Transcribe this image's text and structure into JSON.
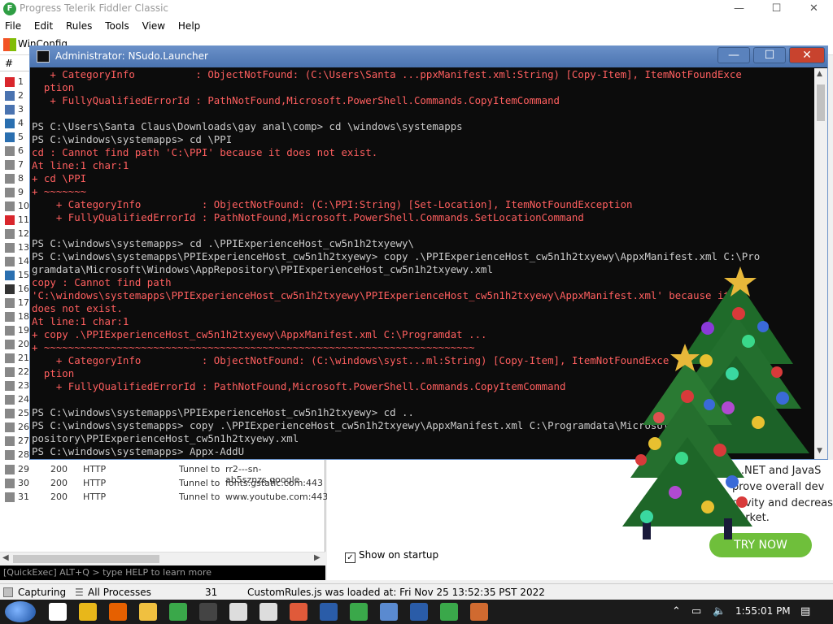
{
  "fiddler": {
    "title": "Progress Telerik Fiddler Classic",
    "window_controls": {
      "minimize": "—",
      "maximize": "☐",
      "close": "✕"
    },
    "menu": [
      "File",
      "Edit",
      "Rules",
      "Tools",
      "View",
      "Help"
    ],
    "toolbar_partial": "WinConfig",
    "sessions_header": "#",
    "sessions": [
      {
        "num": "1",
        "icon": "warning-icon",
        "color": "#d9262c"
      },
      {
        "num": "2",
        "icon": "js-icon",
        "color": "#4a73b0"
      },
      {
        "num": "3",
        "icon": "js-icon",
        "color": "#4a73b0"
      },
      {
        "num": "4",
        "icon": "html-icon",
        "color": "#2a6fb0"
      },
      {
        "num": "5",
        "icon": "script-icon",
        "color": "#2a6fb0"
      },
      {
        "num": "6",
        "icon": "lock-icon",
        "color": "#888888"
      },
      {
        "num": "7",
        "icon": "lock-icon",
        "color": "#888888"
      },
      {
        "num": "8",
        "icon": "lock-icon",
        "color": "#888888"
      },
      {
        "num": "9",
        "icon": "lock-icon",
        "color": "#888888"
      },
      {
        "num": "10",
        "icon": "lock-icon",
        "color": "#888888"
      },
      {
        "num": "11",
        "icon": "blocked-icon",
        "color": "#d9262c"
      },
      {
        "num": "12",
        "icon": "lock-icon",
        "color": "#888888"
      },
      {
        "num": "13",
        "icon": "lock-icon",
        "color": "#888888"
      },
      {
        "num": "14",
        "icon": "lock-icon",
        "color": "#888888"
      },
      {
        "num": "15",
        "icon": "doc-icon",
        "color": "#2a6fb0"
      },
      {
        "num": "16",
        "icon": "doc-icon",
        "color": "#333333"
      },
      {
        "num": "17",
        "icon": "lock-icon",
        "color": "#888888"
      },
      {
        "num": "18",
        "icon": "lock-icon",
        "color": "#888888"
      },
      {
        "num": "19",
        "icon": "lock-icon",
        "color": "#888888"
      },
      {
        "num": "20",
        "icon": "lock-icon",
        "color": "#888888"
      },
      {
        "num": "21",
        "icon": "lock-icon",
        "color": "#888888"
      },
      {
        "num": "22",
        "icon": "lock-icon",
        "color": "#888888"
      },
      {
        "num": "23",
        "icon": "lock-icon",
        "color": "#888888"
      },
      {
        "num": "24",
        "icon": "lock-icon",
        "color": "#888888"
      },
      {
        "num": "25",
        "icon": "lock-icon",
        "color": "#888888"
      },
      {
        "num": "26",
        "icon": "lock-icon",
        "color": "#888888"
      },
      {
        "num": "27",
        "icon": "lock-icon",
        "color": "#888888"
      },
      {
        "num": "28",
        "icon": "lock-icon",
        "color": "#888888"
      }
    ],
    "sessions_visible": [
      {
        "num": "29",
        "result": "200",
        "protocol": "HTTP",
        "host": "Tunnel to",
        "url": "rr2---sn-ab5sznzs.google"
      },
      {
        "num": "30",
        "result": "200",
        "protocol": "HTTP",
        "host": "Tunnel to",
        "url": "fonts.gstatic.com:443"
      },
      {
        "num": "31",
        "result": "200",
        "protocol": "HTTP",
        "host": "Tunnel to",
        "url": "www.youtube.com:443"
      }
    ],
    "quickexec": "[QuickExec] ALT+Q > type HELP to learn more",
    "promo_lines": [
      "s .NET and JavaS",
      "prove overall dev",
      "ctivity and decreas",
      "narket."
    ],
    "try_now": "TRY NOW",
    "show_on_startup": "Show on startup",
    "status": {
      "capturing": "Capturing",
      "processes": "All Processes",
      "count": "31",
      "message": "CustomRules.js was loaded at: Fri Nov 25 13:52:35 PST 2022"
    }
  },
  "console": {
    "title": "Administrator: NSudo.Launcher",
    "lines": [
      {
        "t": "   + CategoryInfo          : ObjectNotFound: (C:\\Users\\Santa ...ppxManifest.xml:String) [Copy-Item], ItemNotFoundExce",
        "k": "err"
      },
      {
        "t": "  ption",
        "k": "err"
      },
      {
        "t": "   + FullyQualifiedErrorId : PathNotFound,Microsoft.PowerShell.Commands.CopyItemCommand",
        "k": "err"
      },
      {
        "t": "",
        "k": ""
      },
      {
        "t": "PS C:\\Users\\Santa Claus\\Downloads\\gay anal\\comp> cd \\windows\\systemapps",
        "k": ""
      },
      {
        "t": "PS C:\\windows\\systemapps> cd \\PPI",
        "k": ""
      },
      {
        "t": "cd : Cannot find path 'C:\\PPI' because it does not exist.",
        "k": "err"
      },
      {
        "t": "At line:1 char:1",
        "k": "err"
      },
      {
        "t": "+ cd \\PPI",
        "k": "err"
      },
      {
        "t": "+ ~~~~~~~",
        "k": "err"
      },
      {
        "t": "    + CategoryInfo          : ObjectNotFound: (C:\\PPI:String) [Set-Location], ItemNotFoundException",
        "k": "err"
      },
      {
        "t": "    + FullyQualifiedErrorId : PathNotFound,Microsoft.PowerShell.Commands.SetLocationCommand",
        "k": "err"
      },
      {
        "t": "",
        "k": ""
      },
      {
        "t": "PS C:\\windows\\systemapps> cd .\\PPIExperienceHost_cw5n1h2txyewy\\",
        "k": ""
      },
      {
        "t": "PS C:\\windows\\systemapps\\PPIExperienceHost_cw5n1h2txyewy> copy .\\PPIExperienceHost_cw5n1h2txyewy\\AppxManifest.xml C:\\Pro",
        "k": ""
      },
      {
        "t": "gramdata\\Microsoft\\Windows\\AppRepository\\PPIExperienceHost_cw5n1h2txyewy.xml",
        "k": ""
      },
      {
        "t": "copy : Cannot find path",
        "k": "err"
      },
      {
        "t": "'C:\\windows\\systemapps\\PPIExperienceHost_cw5n1h2txyewy\\PPIExperienceHost_cw5n1h2txyewy\\AppxManifest.xml' because it",
        "k": "err"
      },
      {
        "t": "does not exist.",
        "k": "err"
      },
      {
        "t": "At line:1 char:1",
        "k": "err"
      },
      {
        "t": "+ copy .\\PPIExperienceHost_cw5n1h2txyewy\\AppxManifest.xml C:\\Programdat ...",
        "k": "err"
      },
      {
        "t": "+ ~~~~~~~~~~~~~~~~~~~~~~~~~~~~~~~~~~~~~~~~~~~~~~~~~~~~~~~~~~~~~~~~~~~~~~~",
        "k": "err"
      },
      {
        "t": "    + CategoryInfo          : ObjectNotFound: (C:\\windows\\syst...ml:String) [Copy-Item], ItemNotFoundExce",
        "k": "err"
      },
      {
        "t": "  ption",
        "k": "err"
      },
      {
        "t": "    + FullyQualifiedErrorId : PathNotFound,Microsoft.PowerShell.Commands.CopyItemCommand",
        "k": "err"
      },
      {
        "t": "",
        "k": ""
      },
      {
        "t": "PS C:\\windows\\systemapps\\PPIExperienceHost_cw5n1h2txyewy> cd ..",
        "k": ""
      },
      {
        "t": "PS C:\\windows\\systemapps> copy .\\PPIExperienceHost_cw5n1h2txyewy\\AppxManifest.xml C:\\Programdata\\Microsoft\\Windows\\AppRe",
        "k": ""
      },
      {
        "t": "pository\\PPIExperienceHost_cw5n1h2txyewy.xml",
        "k": ""
      },
      {
        "t": "PS C:\\windows\\systemapps> Appx-AddU",
        "k": ""
      }
    ]
  },
  "taskbar": {
    "apps": [
      {
        "name": "task-view-icon",
        "color": "#ffffff"
      },
      {
        "name": "chrome-icon",
        "color": "#e8b71a"
      },
      {
        "name": "firefox-icon",
        "color": "#e66000"
      },
      {
        "name": "file-explorer-icon",
        "color": "#f0c040"
      },
      {
        "name": "fiddler-icon",
        "color": "#3aa84a"
      },
      {
        "name": "cmd-icon",
        "color": "#444444"
      },
      {
        "name": "package-icon",
        "color": "#dddddd"
      },
      {
        "name": "7zip-icon",
        "color": "#dddddd"
      },
      {
        "name": "git-icon",
        "color": "#e05a3a"
      },
      {
        "name": "powershell-icon",
        "color": "#2a5ca8"
      },
      {
        "name": "fiddler-alt-icon",
        "color": "#3aa84a"
      },
      {
        "name": "control-panel-icon",
        "color": "#5a8ad0"
      },
      {
        "name": "powershell-active-icon",
        "color": "#2a5ca8"
      },
      {
        "name": "fiddler-active-icon",
        "color": "#3aa84a"
      },
      {
        "name": "archive-icon",
        "color": "#d06a30"
      }
    ],
    "time": "1:55:01 PM"
  }
}
